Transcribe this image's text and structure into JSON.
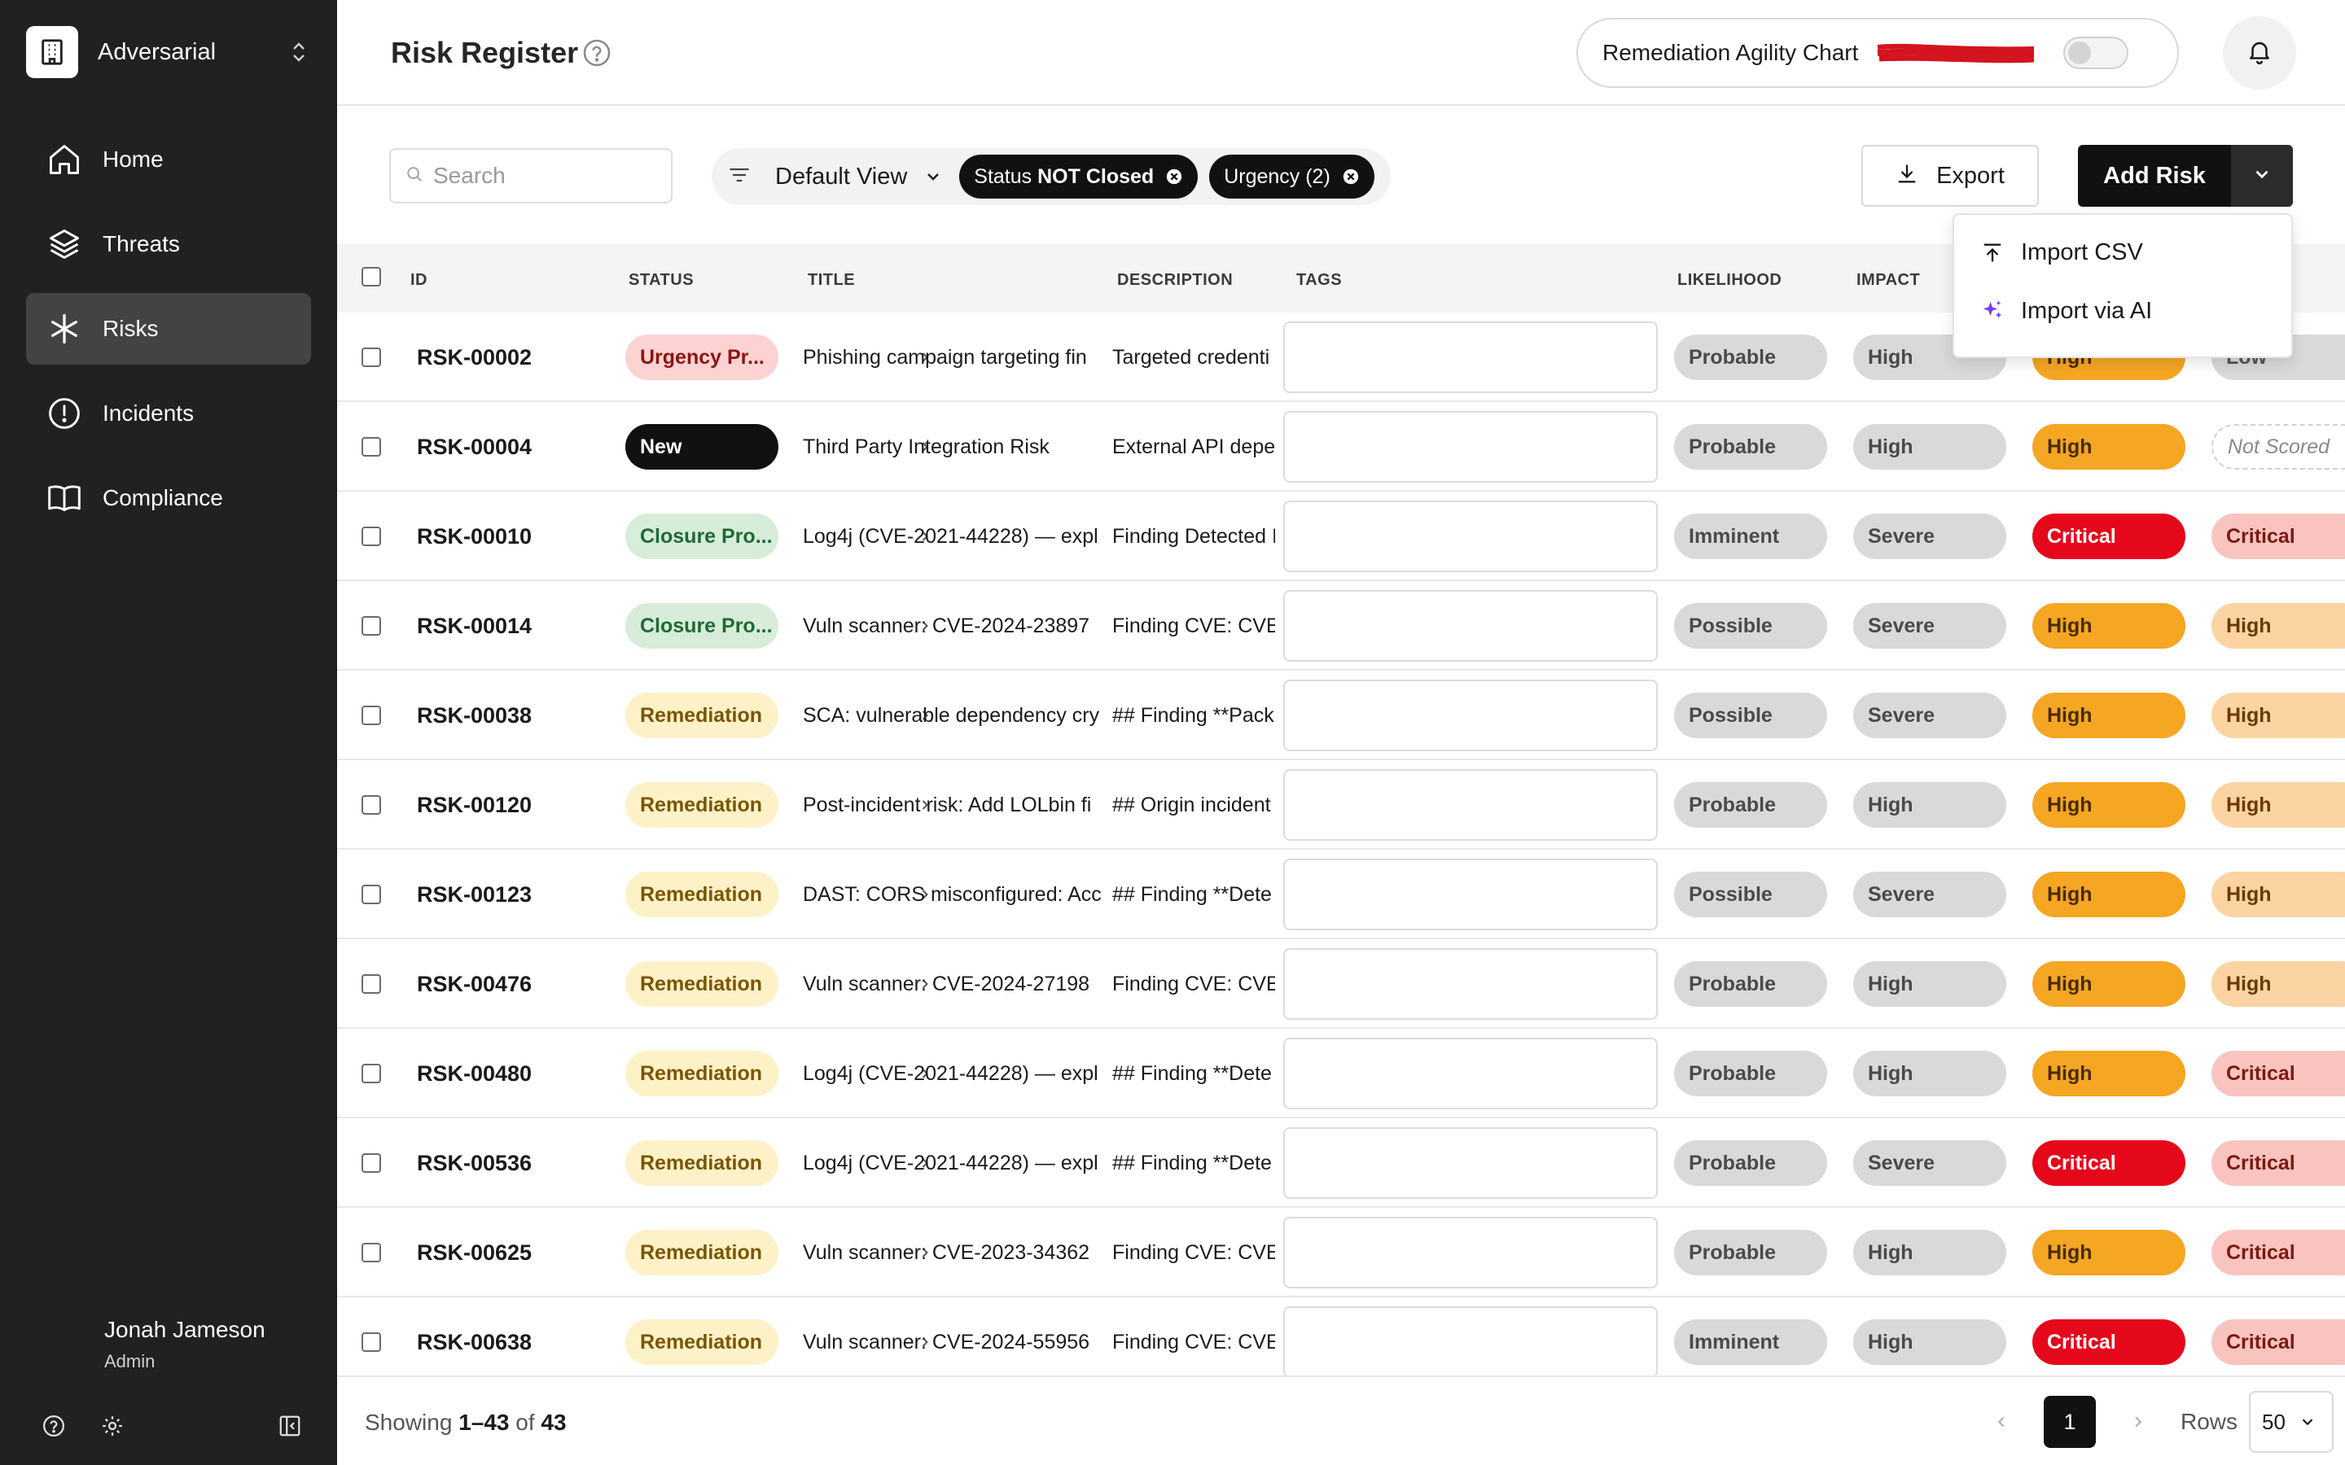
{
  "sidebar": {
    "org_name": "Adversarial",
    "nav": [
      {
        "label": "Home",
        "icon": "home-icon"
      },
      {
        "label": "Threats",
        "icon": "layers-icon"
      },
      {
        "label": "Risks",
        "icon": "asterisk-icon",
        "active": true
      },
      {
        "label": "Incidents",
        "icon": "alert-circle-icon"
      },
      {
        "label": "Compliance",
        "icon": "book-icon"
      }
    ],
    "user": {
      "name": "Jonah Jameson",
      "role": "Admin"
    }
  },
  "header": {
    "title": "Risk Register",
    "chart_toggle_label": "Remediation Agility Chart",
    "chart_toggle_on": false
  },
  "toolbar": {
    "search_placeholder": "Search",
    "view_label": "Default View",
    "chips": [
      {
        "prefix": "Status",
        "value": "NOT Closed"
      },
      {
        "prefix": "Urgency",
        "value": "(2)"
      }
    ],
    "export_label": "Export",
    "add_risk_label": "Add Risk"
  },
  "dropdown": {
    "items": [
      {
        "label": "Import CSV",
        "icon": "upload-icon"
      },
      {
        "label": "Import via AI",
        "icon": "sparkle-icon"
      }
    ]
  },
  "table": {
    "columns": [
      "ID",
      "STATUS",
      "TITLE",
      "DESCRIPTION",
      "TAGS",
      "LIKELIHOOD",
      "IMPACT"
    ],
    "rows": [
      {
        "id": "RSK-00002",
        "status": "Urgency Pr...",
        "status_kind": "urgency",
        "title": "Phishing campaign targeting fin",
        "description": "Targeted credenti",
        "likelihood": "Probable",
        "impact": "High",
        "score": "High",
        "score_kind": "high",
        "residual": "Low",
        "residual_kind": "light-low"
      },
      {
        "id": "RSK-00004",
        "status": "New",
        "status_kind": "new",
        "title": "Third Party Integration Risk",
        "description": "External API depe",
        "likelihood": "Probable",
        "impact": "High",
        "score": "High",
        "score_kind": "high",
        "residual": "Not Scored",
        "residual_kind": "notscored"
      },
      {
        "id": "RSK-00010",
        "status": "Closure Pro...",
        "status_kind": "closure",
        "title": "Log4j (CVE-2021-44228) — expl",
        "description": "Finding Detected I",
        "likelihood": "Imminent",
        "impact": "Severe",
        "score": "Critical",
        "score_kind": "critical",
        "residual": "Critical",
        "residual_kind": "light-critical"
      },
      {
        "id": "RSK-00014",
        "status": "Closure Pro...",
        "status_kind": "closure",
        "title": "Vuln scanner: CVE-2024-23897",
        "description": "Finding CVE: CVE-",
        "likelihood": "Possible",
        "impact": "Severe",
        "score": "High",
        "score_kind": "high",
        "residual": "High",
        "residual_kind": "light-high"
      },
      {
        "id": "RSK-00038",
        "status": "Remediation",
        "status_kind": "remediation",
        "title": "SCA: vulnerable dependency cry",
        "description": "## Finding **Pack",
        "likelihood": "Possible",
        "impact": "Severe",
        "score": "High",
        "score_kind": "high",
        "residual": "High",
        "residual_kind": "light-high"
      },
      {
        "id": "RSK-00120",
        "status": "Remediation",
        "status_kind": "remediation",
        "title": "Post-incident risk: Add LOLbin fi",
        "description": "## Origin incident",
        "likelihood": "Probable",
        "impact": "High",
        "score": "High",
        "score_kind": "high",
        "residual": "High",
        "residual_kind": "light-high"
      },
      {
        "id": "RSK-00123",
        "status": "Remediation",
        "status_kind": "remediation",
        "title": "DAST: CORS misconfigured: Acc",
        "description": "## Finding **Dete",
        "likelihood": "Possible",
        "impact": "Severe",
        "score": "High",
        "score_kind": "high",
        "residual": "High",
        "residual_kind": "light-high"
      },
      {
        "id": "RSK-00476",
        "status": "Remediation",
        "status_kind": "remediation",
        "title": "Vuln scanner: CVE-2024-27198",
        "description": "Finding CVE: CVE-",
        "likelihood": "Probable",
        "impact": "High",
        "score": "High",
        "score_kind": "high",
        "residual": "High",
        "residual_kind": "light-high"
      },
      {
        "id": "RSK-00480",
        "status": "Remediation",
        "status_kind": "remediation",
        "title": "Log4j (CVE-2021-44228) — expl",
        "description": "## Finding **Dete",
        "likelihood": "Probable",
        "impact": "High",
        "score": "High",
        "score_kind": "high",
        "residual": "Critical",
        "residual_kind": "light-critical"
      },
      {
        "id": "RSK-00536",
        "status": "Remediation",
        "status_kind": "remediation",
        "title": "Log4j (CVE-2021-44228) — expl",
        "description": "## Finding **Dete",
        "likelihood": "Probable",
        "impact": "Severe",
        "score": "Critical",
        "score_kind": "critical",
        "residual": "Critical",
        "residual_kind": "light-critical"
      },
      {
        "id": "RSK-00625",
        "status": "Remediation",
        "status_kind": "remediation",
        "title": "Vuln scanner: CVE-2023-34362",
        "description": "Finding CVE: CVE-",
        "likelihood": "Probable",
        "impact": "High",
        "score": "High",
        "score_kind": "high",
        "residual": "Critical",
        "residual_kind": "light-critical"
      },
      {
        "id": "RSK-00638",
        "status": "Remediation",
        "status_kind": "remediation",
        "title": "Vuln scanner: CVE-2024-55956",
        "description": "Finding CVE: CVE-",
        "likelihood": "Imminent",
        "impact": "High",
        "score": "Critical",
        "score_kind": "critical",
        "residual": "Critical",
        "residual_kind": "light-critical"
      }
    ]
  },
  "footer": {
    "showing_prefix": "Showing",
    "showing_range": "1–43",
    "showing_of": "of",
    "showing_total": "43",
    "current_page": "1",
    "rows_label": "Rows",
    "rows_value": "50"
  },
  "colors": {
    "sidebar_bg": "#212121",
    "sidebar_active": "#434343",
    "accent_black": "#111111",
    "high": "#f5a623",
    "critical": "#e5071a",
    "ai_purple": "#7c3aed"
  }
}
